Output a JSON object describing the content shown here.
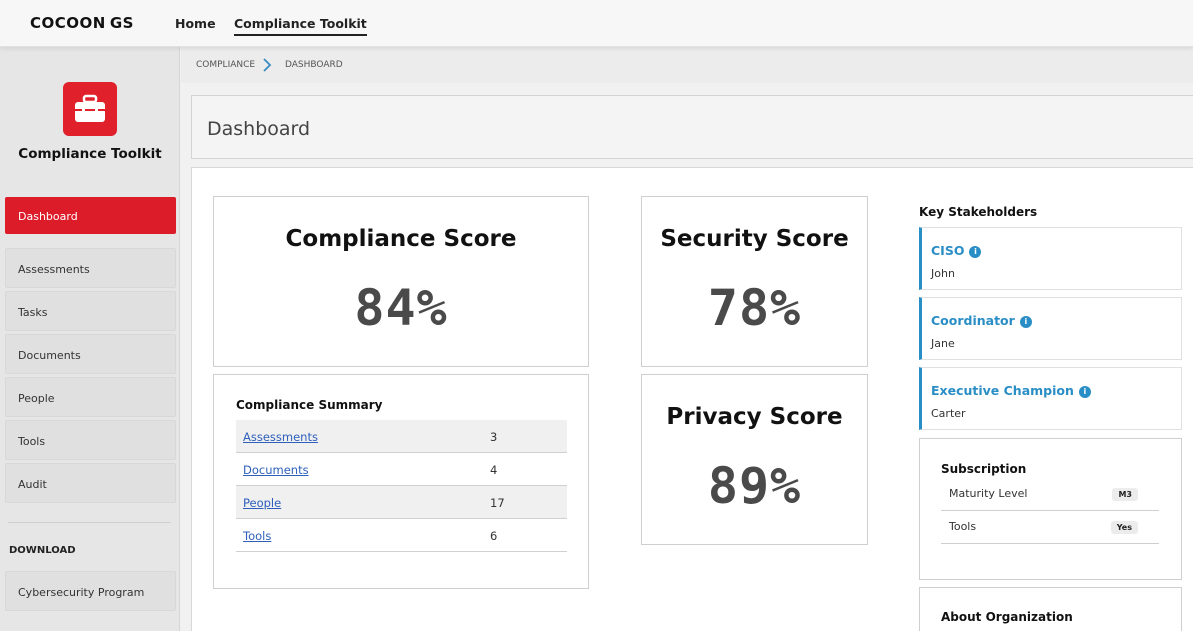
{
  "brand": {
    "name": "COCOON",
    "suffix": "GS"
  },
  "topnav": {
    "home": "Home",
    "toolkit": "Compliance Toolkit"
  },
  "sidebar": {
    "app_name": "Compliance Toolkit",
    "items": [
      {
        "label": "Dashboard",
        "active": true
      },
      {
        "label": "Assessments"
      },
      {
        "label": "Tasks"
      },
      {
        "label": "Documents"
      },
      {
        "label": "People"
      },
      {
        "label": "Tools"
      },
      {
        "label": "Audit"
      }
    ],
    "download_heading": "DOWNLOAD",
    "download_items": [
      {
        "label": "Cybersecurity Program"
      }
    ]
  },
  "breadcrumb": {
    "level1": "COMPLIANCE",
    "level2": "DASHBOARD"
  },
  "page": {
    "title": "Dashboard"
  },
  "scores": {
    "compliance": {
      "title": "Compliance Score",
      "value": "84%"
    },
    "security": {
      "title": "Security Score",
      "value": "78%"
    },
    "privacy": {
      "title": "Privacy Score",
      "value": "89%"
    }
  },
  "summary": {
    "title": "Compliance Summary",
    "rows": [
      {
        "label": "Assessments",
        "count": "3"
      },
      {
        "label": "Documents",
        "count": "4"
      },
      {
        "label": "People",
        "count": "17"
      },
      {
        "label": "Tools",
        "count": "6"
      }
    ]
  },
  "stakeholders": {
    "heading": "Key Stakeholders",
    "items": [
      {
        "role": "CISO",
        "name": "John"
      },
      {
        "role": "Coordinator",
        "name": "Jane"
      },
      {
        "role": "Executive Champion",
        "name": "Carter"
      }
    ]
  },
  "subscription": {
    "title": "Subscription",
    "rows": [
      {
        "label": "Maturity Level",
        "value": "M3"
      },
      {
        "label": "Tools",
        "value": "Yes"
      }
    ]
  },
  "organization": {
    "title": "About Organization"
  },
  "colors": {
    "accent": "#dd1c2a",
    "link": "#2d5fbb",
    "stakeholder": "#2a8ec6"
  }
}
